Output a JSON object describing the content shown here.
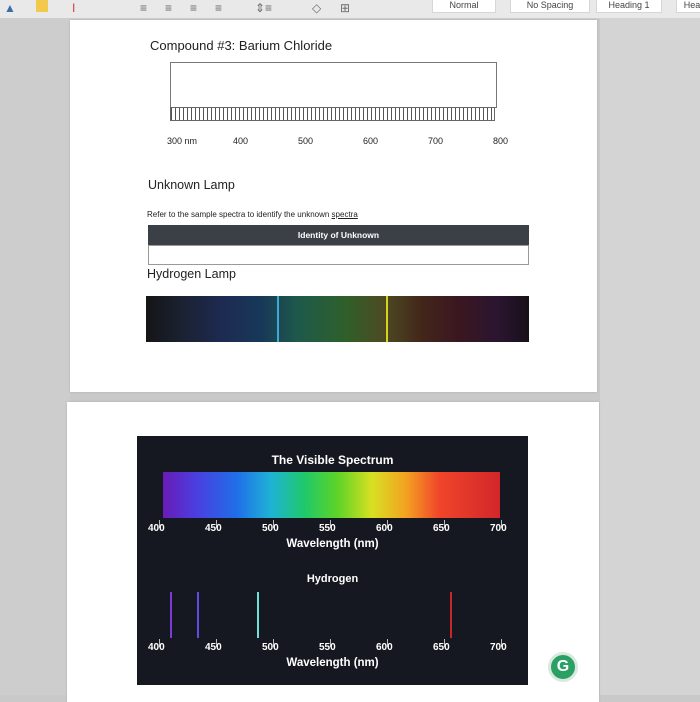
{
  "ribbon": {
    "styles": [
      "Normal",
      "No Spacing",
      "Heading 1",
      "Hea"
    ]
  },
  "page1": {
    "compound_title": "Compound #3: Barium Chloride",
    "ruler_labels": [
      "300 nm",
      "400",
      "500",
      "600",
      "700",
      "800"
    ],
    "unknown_title": "Unknown Lamp",
    "refer_text": "Refer to the sample spectra to identify the unknown ",
    "refer_link": "spectra",
    "table_header": "Identity of Unknown",
    "hydrogen_title": "Hydrogen Lamp",
    "hydrogen_lines": [
      {
        "color": "#3da7d8"
      },
      {
        "color": "#d7d221"
      }
    ]
  },
  "page2": {
    "spectrum_title": "The Visible Spectrum",
    "axis_ticks": [
      "400",
      "450",
      "500",
      "550",
      "600",
      "650",
      "700"
    ],
    "axis_label": "Wavelength (nm)",
    "emission_title": "Hydrogen",
    "emission_lines": [
      {
        "nm": 410,
        "color": "#7a3bd6"
      },
      {
        "nm": 434,
        "color": "#5a4fe0"
      },
      {
        "nm": 486,
        "color": "#6fe0d8"
      },
      {
        "nm": 656,
        "color": "#c9262b"
      }
    ]
  },
  "badge": {
    "letter": "G",
    "color": "#2aa065"
  }
}
